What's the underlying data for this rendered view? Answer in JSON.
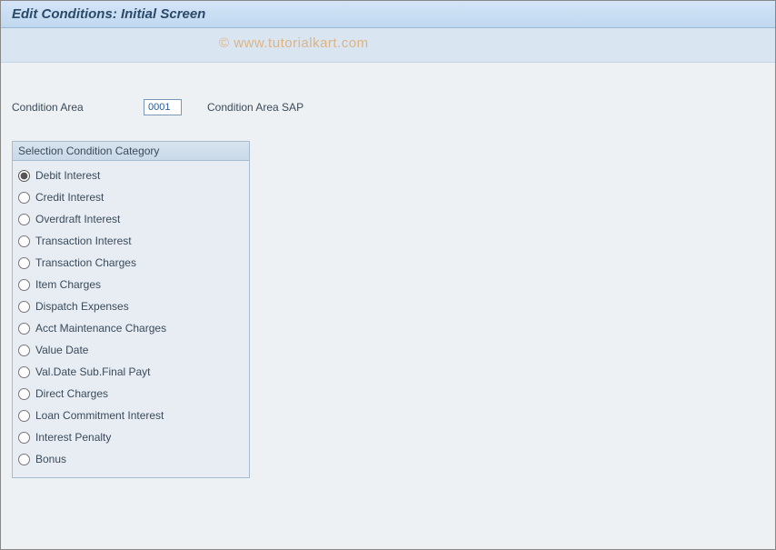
{
  "title": "Edit Conditions: Initial Screen",
  "watermark": "© www.tutorialkart.com",
  "condition_area": {
    "label": "Condition Area",
    "value": "0001",
    "description": "Condition Area SAP"
  },
  "group": {
    "title": "Selection Condition Category",
    "selected_index": 0,
    "options": [
      "Debit Interest",
      "Credit Interest",
      "Overdraft Interest",
      "Transaction Interest",
      "Transaction Charges",
      "Item Charges",
      "Dispatch Expenses",
      "Acct Maintenance Charges",
      "Value Date",
      "Val.Date Sub.Final Payt",
      "Direct Charges",
      "Loan Commitment Interest",
      "Interest Penalty",
      "Bonus"
    ]
  }
}
